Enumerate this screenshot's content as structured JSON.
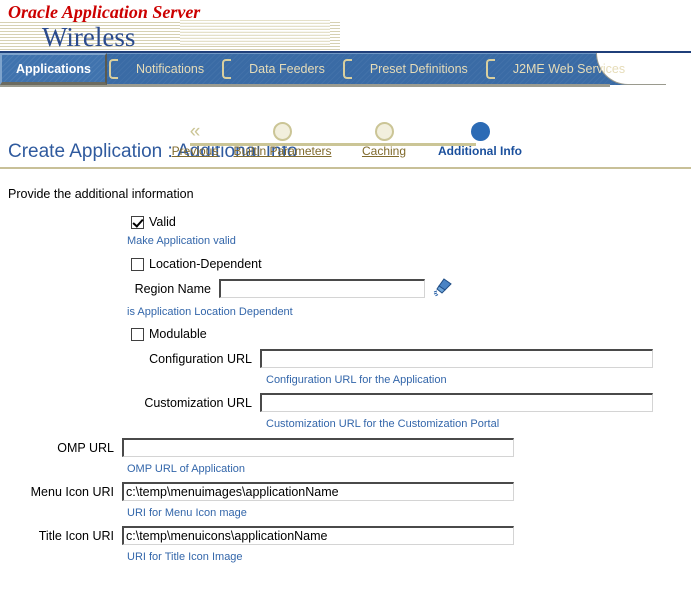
{
  "branding": {
    "line1": "Oracle Application Server",
    "line2": "Wireless"
  },
  "tabs": [
    {
      "label": "Applications",
      "active": true
    },
    {
      "label": "Notifications",
      "active": false
    },
    {
      "label": "Data Feeders",
      "active": false
    },
    {
      "label": "Preset Definitions",
      "active": false
    },
    {
      "label": "J2ME Web Services",
      "active": false
    }
  ],
  "train": {
    "previous_label": "Previous",
    "previous_arrow": "«",
    "steps": [
      {
        "label": "Builtin Parameters",
        "state": "done"
      },
      {
        "label": "Caching",
        "state": "done"
      },
      {
        "label": "Additional Info",
        "state": "current"
      }
    ]
  },
  "page": {
    "title": "Create Application : Additional Info",
    "instruction": "Provide the additional information"
  },
  "form": {
    "valid": {
      "label": "Valid",
      "checked": true,
      "hint": "Make Application valid"
    },
    "location_dependent": {
      "label": "Location-Dependent",
      "checked": false,
      "hint": "is Application Location Dependent"
    },
    "region_name": {
      "label": "Region Name",
      "value": "",
      "icon": "flashlight-icon"
    },
    "modulable": {
      "label": "Modulable",
      "checked": false
    },
    "configuration_url": {
      "label": "Configuration URL",
      "value": "",
      "hint": "Configuration URL for the Application"
    },
    "customization_url": {
      "label": "Customization URL",
      "value": "",
      "hint": "Customization URL for the Customization Portal"
    },
    "omp_url": {
      "label": "OMP URL",
      "value": "",
      "hint": "OMP URL of Application"
    },
    "menu_icon_uri": {
      "label": "Menu Icon URI",
      "value": "c:\\temp\\menuimages\\applicationName",
      "hint": "URI for Menu Icon mage"
    },
    "title_icon_uri": {
      "label": "Title Icon URI",
      "value": "c:\\temp\\menuicons\\applicationName",
      "hint": "URI for Title Icon Image"
    }
  },
  "colors": {
    "brand_red": "#cc0000",
    "brand_blue": "#2b4b8c",
    "tab_bar_blue": "#3a6ba5",
    "tab_text": "#e6dcb8",
    "title_blue": "#2f5a9e",
    "hint_blue": "#3366aa",
    "link_olive": "#806a2c",
    "rule_tan": "#c8c098",
    "current_step_blue": "#2c6bb5"
  }
}
